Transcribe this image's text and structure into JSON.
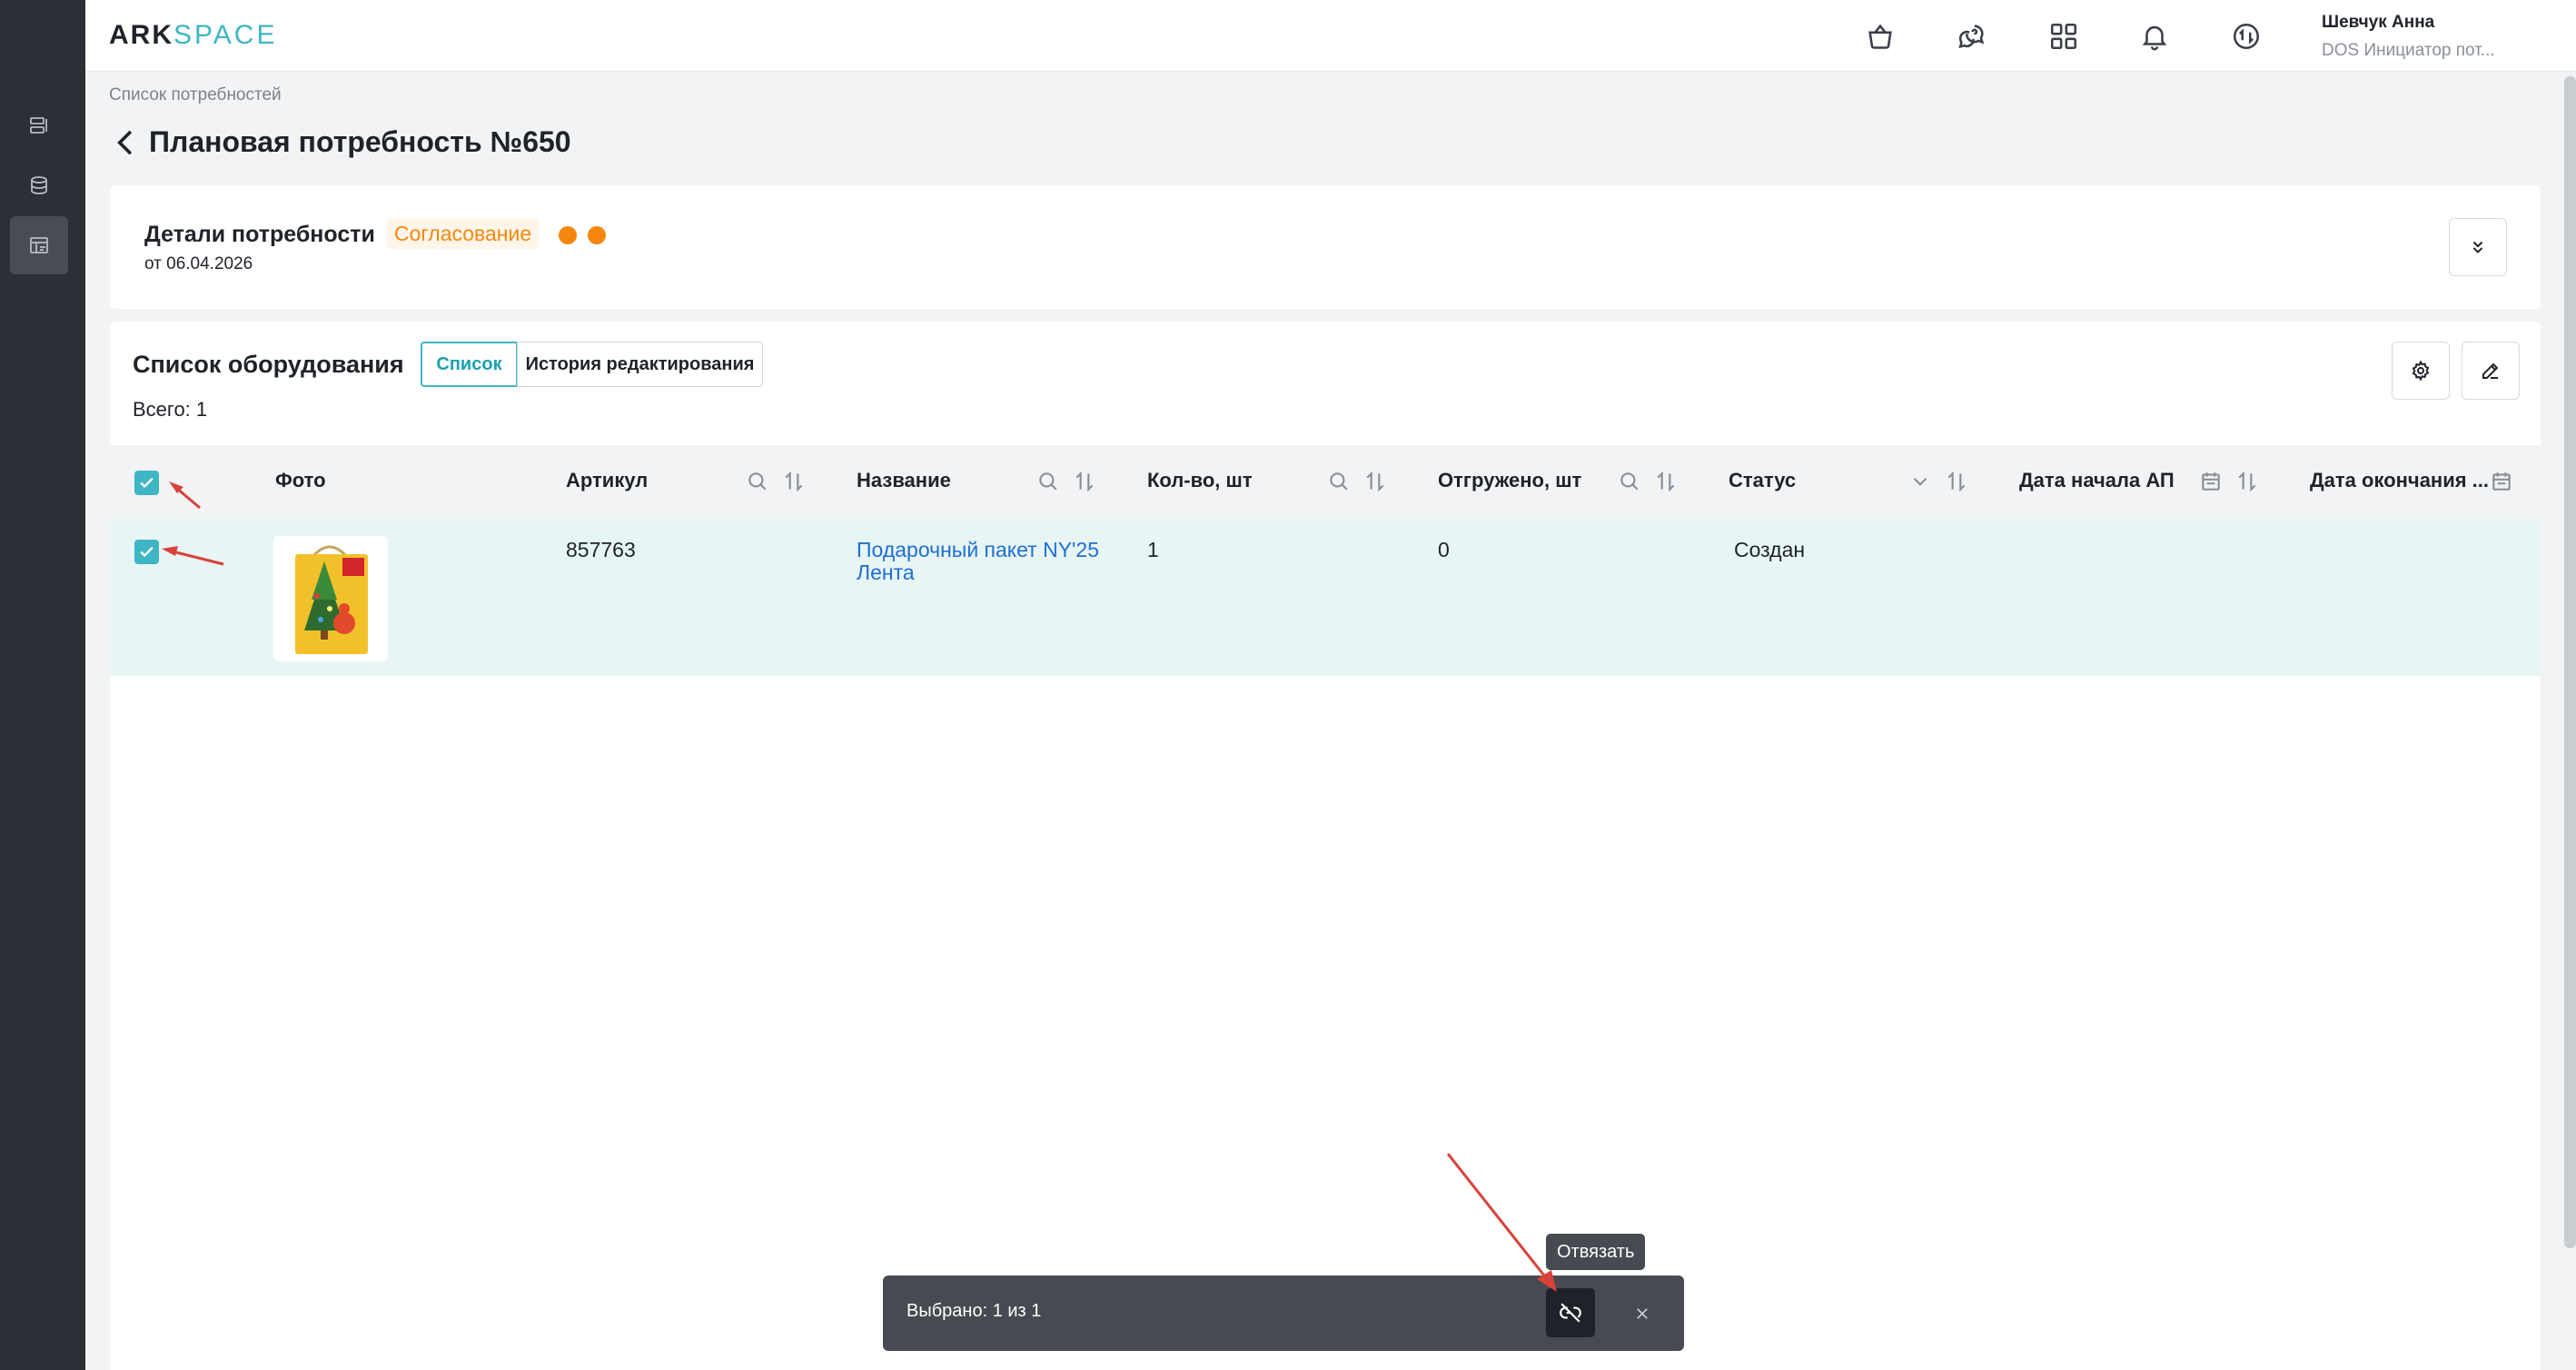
{
  "brand": {
    "logo_a": "ARK",
    "logo_b": "SPACE"
  },
  "header": {
    "icons": [
      "basket-icon",
      "support-chat-icon",
      "apps-grid-icon",
      "bell-icon",
      "sync-icon"
    ]
  },
  "user": {
    "name": "Шевчук Анна",
    "role": "DOS Инициатор пот..."
  },
  "breadcrumb": "Список потребностей",
  "page_title": "Плановая потребность №650",
  "details": {
    "title": "Детали потребности",
    "date": "от 06.04.2026",
    "status": "Согласование",
    "status_color": "#f5870f"
  },
  "equipment": {
    "title": "Список оборудования",
    "total": "Всего: 1",
    "tabs": [
      "Список",
      "История редактирования"
    ],
    "columns": [
      "Фото",
      "Артикул",
      "Название",
      "Кол-во, шт",
      "Отгружено, шт",
      "Статус",
      "Дата начала АП",
      "Дата окончания ..."
    ],
    "rows": [
      {
        "article": "857763",
        "name_line1": "Подарочный пакет NY'25",
        "name_line2": "Лента",
        "qty": "1",
        "shipped": "0",
        "status": "Создан",
        "selected": true
      }
    ]
  },
  "action_bar": {
    "selected_text": "Выбрано: 1 из 1",
    "tooltip": "Отвязать"
  },
  "colors": {
    "accent": "#3fb6c4",
    "sidebar": "#2b2f36",
    "row_selected": "#e7f5f5",
    "link": "#1f6fd1",
    "annotation": "#d9423a"
  }
}
